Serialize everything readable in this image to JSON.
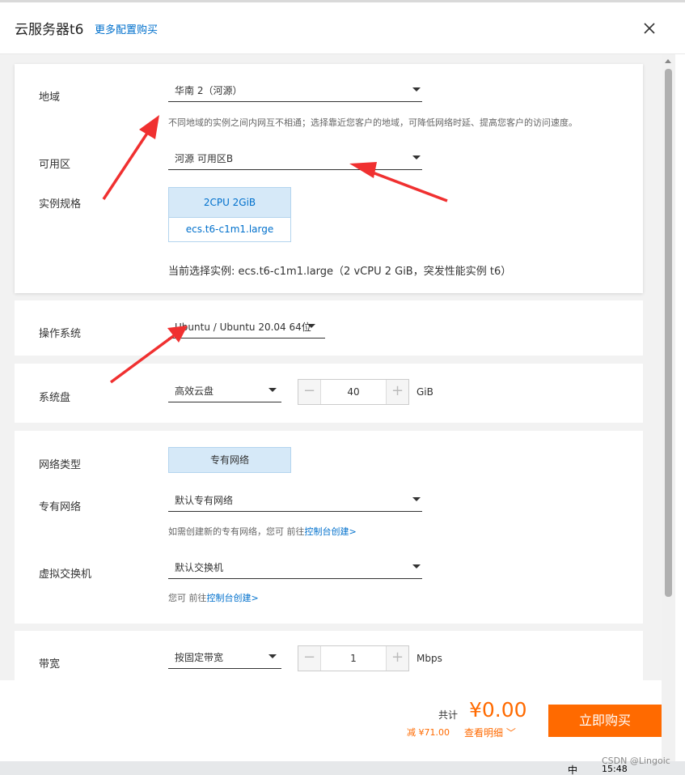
{
  "header": {
    "title": "云服务器t6",
    "more_link": "更多配置购买"
  },
  "region": {
    "label": "地域",
    "value": "华南 2（河源）",
    "hint": "不同地域的实例之间内网互不相通；选择靠近您客户的地域，可降低网络时延、提高您客户的访问速度。"
  },
  "zone": {
    "label": "可用区",
    "value": "河源 可用区B"
  },
  "instance": {
    "label": "实例规格",
    "spec_title": "2CPU 2GiB",
    "spec_code": "ecs.t6-c1m1.large",
    "current": "当前选择实例: ecs.t6-c1m1.large（2 vCPU 2 GiB，突发性能实例 t6）"
  },
  "os": {
    "label": "操作系统",
    "value": "Ubuntu / Ubuntu 20.04 64位"
  },
  "disk": {
    "label": "系统盘",
    "type": "高效云盘",
    "size": "40",
    "unit": "GiB"
  },
  "network": {
    "type_label": "网络类型",
    "type_value": "专有网络",
    "vpc_label": "专有网络",
    "vpc_value": "默认专有网络",
    "vpc_hint_text": "如需创建新的专有网络，您可 前往",
    "vpc_hint_link": "控制台创建>",
    "vswitch_label": "虚拟交换机",
    "vswitch_value": "默认交换机",
    "vswitch_hint_text": "您可 前往",
    "vswitch_hint_link": "控制台创建>"
  },
  "bandwidth": {
    "label": "带宽",
    "mode": "按固定带宽",
    "value": "1",
    "unit": "Mbps"
  },
  "stepper_icons": {
    "minus": "−",
    "plus": "+"
  },
  "footer": {
    "total_label": "共计",
    "price": "¥0.00",
    "discount": "减 ¥71.00",
    "detail": "查看明细 ﹀",
    "buy": "立即购买"
  },
  "taskbar": {
    "time": "15:48",
    "ime": "中"
  },
  "watermark": "CSDN @Lingoic",
  "colors": {
    "accent": "#ff6a00",
    "link": "#0070cc",
    "selected_bg": "#d6e9f8",
    "annotation_arrow": "#f03030"
  }
}
